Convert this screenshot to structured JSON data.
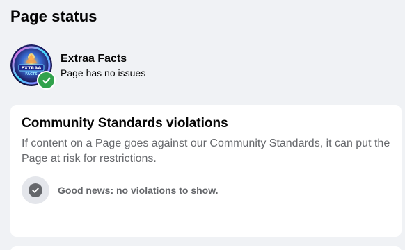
{
  "header": {
    "title": "Page status"
  },
  "profile": {
    "name": "Extraa Facts",
    "status": "Page has no issues",
    "avatar_text": "EXTRAA FACTS",
    "badge_icon": "check-circle-icon",
    "badge_color": "#31a24c"
  },
  "community_standards": {
    "title": "Community Standards violations",
    "description": "If content on a Page goes against our Community Standards, it can put the Page at risk for restrictions.",
    "status_icon": "check-circle-icon",
    "status_text": "Good news: no violations to show."
  },
  "colors": {
    "background": "#f0f2f5",
    "card": "#ffffff",
    "secondary_text": "#65676b",
    "success": "#31a24c"
  }
}
